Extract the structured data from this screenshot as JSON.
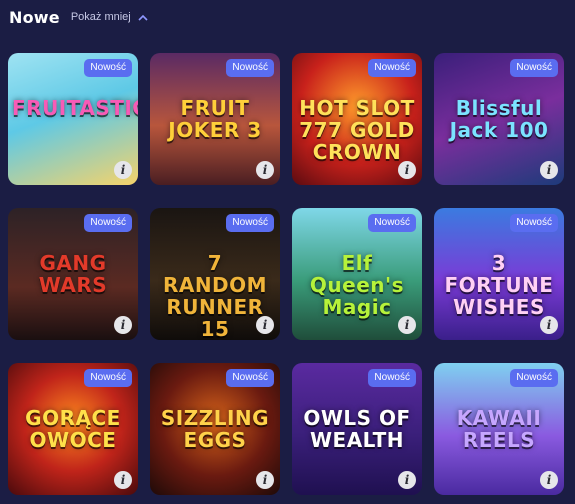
{
  "header": {
    "title": "Nowe",
    "toggle_label": "Pokaż mniej"
  },
  "badge_label": "Nowość",
  "info_glyph": "i",
  "games": [
    {
      "art_text": "FRUITASTIC",
      "bg": "linear-gradient(160deg,#9fe3f2 0%,#5ec9e6 45%,#f6d36a 100%)",
      "color": "#f75bb6"
    },
    {
      "art_text": "FRUIT JOKER 3",
      "bg": "linear-gradient(180deg,#5a2a64 0%,#b8563c 55%,#4a1e22 100%)",
      "color": "#ffcf3a"
    },
    {
      "art_text": "HOT SLOT 777 GOLD CROWN",
      "bg": "radial-gradient(circle at 50% 40%,#ff9a2b 0%,#c8211b 55%,#5a0b10 100%)",
      "color": "#ffe15a"
    },
    {
      "art_text": "Blissful Jack 100",
      "bg": "linear-gradient(160deg,#3a1f7a 0%,#7a2e9d 50%,#1d3b7a 100%)",
      "color": "#7be3ff"
    },
    {
      "art_text": "GANG WARS",
      "bg": "linear-gradient(180deg,#2d2226 0%,#5b2a22 60%,#1a0f10 100%)",
      "color": "#e23a2a"
    },
    {
      "art_text": "7 RANDOM RUNNER 15",
      "bg": "linear-gradient(180deg,#1a1512 0%,#3a2a1a 55%,#0f0c0a 100%)",
      "color": "#f0b43a"
    },
    {
      "art_text": "Elf Queen's Magic",
      "bg": "linear-gradient(180deg,#7fd7e8 0%,#3a9c7a 55%,#1f4d3a 100%)",
      "color": "#b6f23a"
    },
    {
      "art_text": "3 FORTUNE WISHES",
      "bg": "linear-gradient(180deg,#3b7be0 0%,#7a3bd6 55%,#3a1f8a 100%)",
      "color": "#ffd0f5"
    },
    {
      "art_text": "GORĄCE OWOCE",
      "bg": "radial-gradient(circle at 50% 45%,#ff8a1f 0%,#c0241a 50%,#4a0a0c 100%)",
      "color": "#ffe04a"
    },
    {
      "art_text": "SIZZLING EGGS",
      "bg": "radial-gradient(circle at 50% 45%,#d8641a 0%,#6a1a10 55%,#1e0a08 100%)",
      "color": "#ffd24a"
    },
    {
      "art_text": "OWLS OF WEALTH",
      "bg": "linear-gradient(180deg,#5a2aa0 0%,#3a1f7a 55%,#1f1050 100%)",
      "color": "#ffffff"
    },
    {
      "art_text": "KAWAII REELS",
      "bg": "linear-gradient(180deg,#7fd0f0 0%,#8a5ae0 55%,#4a2aa0 100%)",
      "color": "#c6a6ff"
    }
  ]
}
